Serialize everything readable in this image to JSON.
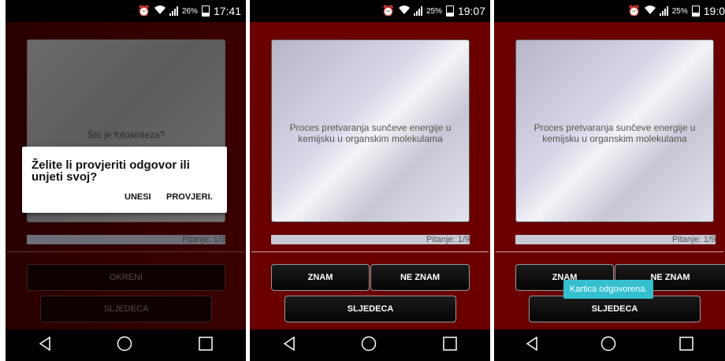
{
  "screens": [
    {
      "status": {
        "battery_pct": "26%",
        "time": "17:41"
      },
      "card_text": "Što je fotosinteza?",
      "progress_text": "Pitanje: 1/3",
      "buttons": {
        "primary": "OKRENI",
        "next": "SLJEDECA"
      },
      "dialog": {
        "title": "Želite li provjeriti odgovor ili unjeti svoj?",
        "btn_enter": "UNESI",
        "btn_check": "PROVJERI."
      }
    },
    {
      "status": {
        "battery_pct": "25%",
        "time": "19:07"
      },
      "card_text": "Proces pretvaranja sunčeve energije u kemijsku u organskim molekulama",
      "progress_text": "Pitanje: 1/9",
      "buttons": {
        "know": "ZNAM",
        "dont_know": "NE ZNAM",
        "next": "SLJEDECA"
      }
    },
    {
      "status": {
        "battery_pct": "25%",
        "time": "19:0"
      },
      "card_text": "Proces pretvaranja sunčeve energije u kemijsku u organskim molekulama",
      "progress_text": "Pitanje: 1/9",
      "buttons": {
        "know": "ZNAM",
        "dont_know": "NE ZNAM",
        "next": "SLJEDECA"
      },
      "toast": "Kartica odgovorena."
    }
  ],
  "icons": {
    "alarm": "alarm-icon",
    "wifi": "wifi-icon",
    "signal": "signal-icon",
    "battery": "battery-icon",
    "back": "back-icon",
    "home": "home-icon",
    "recent": "recent-apps-icon"
  },
  "colors": {
    "background": "#6a0000",
    "toast": "#35c0cf"
  }
}
